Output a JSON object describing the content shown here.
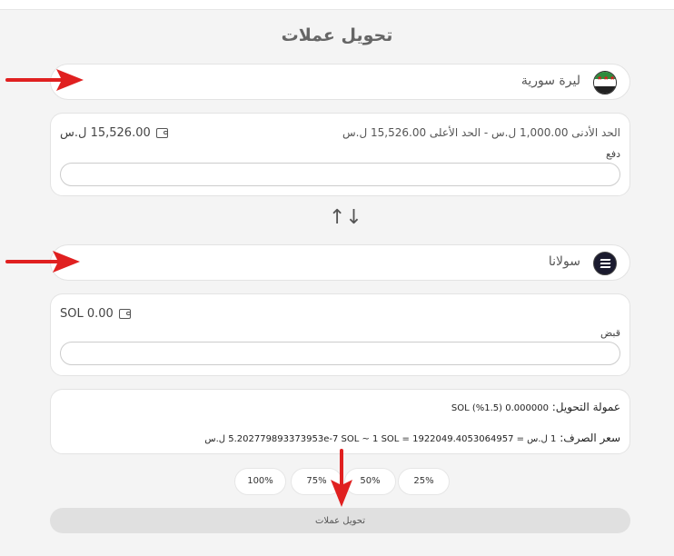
{
  "page": {
    "title": "تحويل عملات"
  },
  "from_currency": {
    "name": "ليرة سورية",
    "icon": "syria-flag-icon"
  },
  "pay_card": {
    "balance": "15,526.00 ل.س",
    "limits": "الحد الأدنى 1,000.00 ل.س  -  الحد الأعلى 15,526.00 ل.س",
    "field_label": "دفع",
    "value": ""
  },
  "swap_icon": "↑↓",
  "to_currency": {
    "name": "سولانا",
    "icon": "solana-icon"
  },
  "receive_card": {
    "balance": "SOL 0.00",
    "field_label": "قبض",
    "value": ""
  },
  "info": {
    "fee_label": "عمولة التحويل:",
    "fee_value": "0.000000 SOL (%1.5)",
    "rate_label": "سعر الصرف:",
    "rate_value": "1 ل.س = 5.202779893373953e-7 SOL ~ 1 SOL = 1922049.4053064957 ل.س"
  },
  "percent_buttons": [
    "25%",
    "50%",
    "75%",
    "100%"
  ],
  "submit_label": "تحويل عملات",
  "colors": {
    "arrow": "#e02020",
    "background": "#f4f4f4",
    "card": "#ffffff",
    "button": "#e0e0e0"
  }
}
